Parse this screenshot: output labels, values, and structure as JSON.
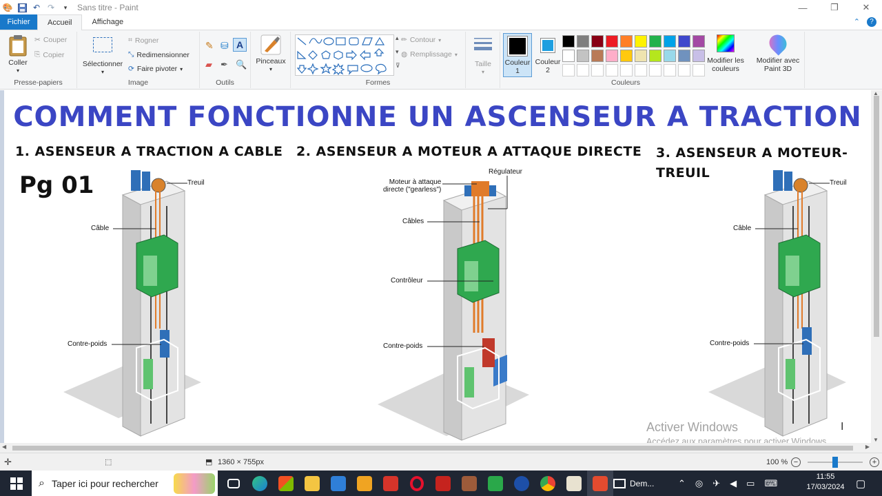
{
  "window": {
    "title": "Sans titre - Paint"
  },
  "tabs": {
    "file": "Fichier",
    "home": "Accueil",
    "view": "Affichage"
  },
  "clipboard": {
    "paste": "Coller",
    "cut": "Couper",
    "copy": "Copier",
    "group": "Presse-papiers"
  },
  "image": {
    "select": "Sélectionner",
    "crop": "Rogner",
    "resize": "Redimensionner",
    "rotate": "Faire pivoter",
    "group": "Image"
  },
  "tools": {
    "group": "Outils"
  },
  "brushes": {
    "label": "Pinceaux"
  },
  "shapes": {
    "outline": "Contour",
    "fill": "Remplissage",
    "group": "Formes"
  },
  "size": {
    "label": "Taille"
  },
  "colors": {
    "color1_line1": "Couleur",
    "color1_line2": "1",
    "color2_line1": "Couleur",
    "color2_line2": "2",
    "edit_line1": "Modifier les",
    "edit_line2": "couleurs",
    "paint3d_line1": "Modifier avec",
    "paint3d_line2": "Paint 3D",
    "group": "Couleurs",
    "color1_value": "#000000",
    "color2_value": "#1e9fe0",
    "palette": [
      "#000000",
      "#7f7f7f",
      "#880015",
      "#ed1c24",
      "#ff7f27",
      "#fff200",
      "#22b14c",
      "#00a2e8",
      "#3f48cc",
      "#a349a4",
      "#ffffff",
      "#c3c3c3",
      "#b97a57",
      "#ffaec9",
      "#ffc90e",
      "#efe4b0",
      "#b5e61d",
      "#99d9ea",
      "#7092be",
      "#c8bfe7"
    ]
  },
  "canvas": {
    "title": "COMMENT FONCTIONNE UN ASCENSEUR A TRACTION",
    "section1": "1. ASENSEUR A TRACTION A CABLE",
    "section2": "2. ASENSEUR A MOTEUR A ATTAQUE DIRECTE",
    "section3_line1": "3. ASENSEUR A MOTEUR-",
    "section3_line2": "TREUIL",
    "page_label": "Pg 01",
    "d1": {
      "winch": "Treuil",
      "cable": "Câble",
      "counterweight": "Contre-poids"
    },
    "d2": {
      "regulator": "Régulateur",
      "motor_line1": "Moteur à attaque",
      "motor_line2": "directe (\"gearless\")",
      "cables": "Câbles",
      "controller": "Contrôleur",
      "counterweight": "Contre-poids"
    },
    "d3": {
      "winch": "Treuil",
      "cable": "Câble",
      "counterweight": "Contre-poids"
    },
    "watermark_line1": "Activer Windows",
    "watermark_line2": "Accédez aux paramètres pour activer Windows."
  },
  "status": {
    "dimensions": "1360 × 755px",
    "zoom": "100 %"
  },
  "taskbar": {
    "search_placeholder": "Taper ici pour rechercher",
    "app_label": "Dem...",
    "time": "11:55",
    "date": "17/03/2024"
  }
}
